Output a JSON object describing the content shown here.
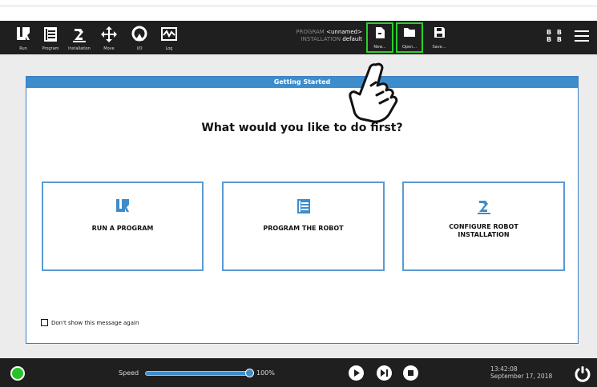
{
  "nav": {
    "items": [
      {
        "label": "Run",
        "icon": "ur-logo-icon"
      },
      {
        "label": "Program",
        "icon": "program-icon"
      },
      {
        "label": "Installation",
        "icon": "installation-icon"
      },
      {
        "label": "Move",
        "icon": "move-icon"
      },
      {
        "label": "I/O",
        "icon": "io-icon"
      },
      {
        "label": "Log",
        "icon": "log-icon"
      }
    ]
  },
  "program_info": {
    "program_label": "PROGRAM",
    "program_value": "<unnamed>",
    "installation_label": "INSTALLATION",
    "installation_value": "default"
  },
  "file_buttons": {
    "new": "New...",
    "open": "Open...",
    "save": "Save..."
  },
  "topright": {
    "bb_row1": "B B",
    "bb_row2": "B B"
  },
  "dialog": {
    "title": "Getting Started",
    "question": "What would you like to do first?",
    "cards": [
      {
        "label": "RUN A PROGRAM",
        "icon": "ur-logo-icon"
      },
      {
        "label": "PROGRAM THE ROBOT",
        "icon": "program-icon"
      },
      {
        "label_line1": "CONFIGURE ROBOT",
        "label_line2": "INSTALLATION",
        "icon": "robot-arm-icon"
      }
    ],
    "checkbox_label": "Don't show this message again"
  },
  "bottom": {
    "speed_label": "Speed",
    "speed_value": "100%",
    "speed_fraction": 1.0,
    "time": "13:42:08",
    "date": "September 17, 2018"
  },
  "colors": {
    "accent": "#3d8ccb",
    "highlight": "#2bcf2b",
    "status_ok": "#27c227",
    "bar_bg": "#1f1f1f"
  }
}
